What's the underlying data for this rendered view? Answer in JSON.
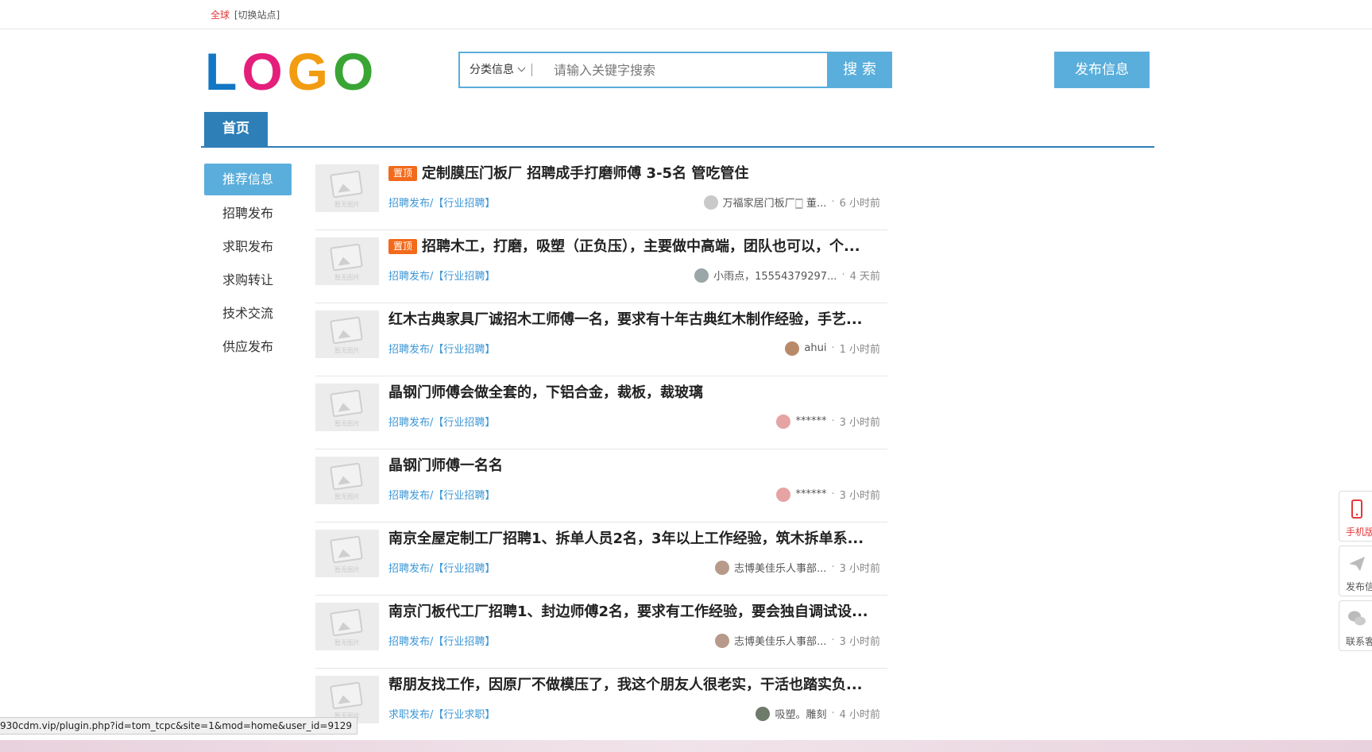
{
  "topbar": {
    "global": "全球",
    "switch": "[切换站点]"
  },
  "logo": {
    "letters": [
      "L",
      "O",
      "G",
      "O"
    ]
  },
  "search": {
    "category": "分类信息",
    "placeholder": "请输入关键字搜索",
    "button": "搜 索"
  },
  "publish_button": "发布信息",
  "nav": {
    "home": "首页"
  },
  "sidebar": {
    "items": [
      {
        "label": "推荐信息",
        "active": true
      },
      {
        "label": "招聘发布",
        "active": false
      },
      {
        "label": "求职发布",
        "active": false
      },
      {
        "label": "求购转让",
        "active": false
      },
      {
        "label": "技术交流",
        "active": false
      },
      {
        "label": "供应发布",
        "active": false
      }
    ]
  },
  "listing": {
    "thumb_caption": "暂无图片",
    "badge": "置顶",
    "items": [
      {
        "title": "定制膜压门板厂 招聘成手打磨师傅 3-5名 管吃管住",
        "top": true,
        "category": "招聘发布/【行业招聘】",
        "author": "万福家居门板厂🀆 董...",
        "time": "6 小时前",
        "avatar": "#c9c9c9"
      },
      {
        "title": "招聘木工，打磨，吸塑（正负压），主要做中高端，团队也可以，个...",
        "top": true,
        "category": "招聘发布/【行业招聘】",
        "author": "小雨点，15554379297...",
        "time": "4 天前",
        "avatar": "#9aa6a8"
      },
      {
        "title": "红木古典家具厂诚招木工师傅一名，要求有十年古典红木制作经验，手艺...",
        "top": false,
        "category": "招聘发布/【行业招聘】",
        "author": "ahui",
        "time": "1 小时前",
        "avatar": "#b98a6a"
      },
      {
        "title": "晶钢门师傅会做全套的，下铝合金，裁板，裁玻璃",
        "top": false,
        "category": "招聘发布/【行业招聘】",
        "author": "******",
        "time": "3 小时前",
        "avatar": "#e6a3a3"
      },
      {
        "title": "晶钢门师傅一名名",
        "top": false,
        "category": "招聘发布/【行业招聘】",
        "author": "******",
        "time": "3 小时前",
        "avatar": "#e6a3a3"
      },
      {
        "title": "南京全屋定制工厂招聘1、拆单人员2名，3年以上工作经验，筑木拆单系...",
        "top": false,
        "category": "招聘发布/【行业招聘】",
        "author": "志博美佳乐人事部...",
        "time": "3 小时前",
        "avatar": "#b89a8a"
      },
      {
        "title": "南京门板代工厂招聘1、封边师傅2名，要求有工作经验，要会独自调试设...",
        "top": false,
        "category": "招聘发布/【行业招聘】",
        "author": "志博美佳乐人事部...",
        "time": "3 小时前",
        "avatar": "#b89a8a"
      },
      {
        "title": "帮朋友找工作，因原厂不做模压了，我这个朋友人很老实，干活也踏实负...",
        "top": false,
        "category": "求职发布/【行业求职】",
        "author": "吸塑。雕刻",
        "time": "4 小时前",
        "avatar": "#6e7a6a"
      }
    ]
  },
  "floaters": [
    {
      "label": "手机版",
      "icon": "phone-icon"
    },
    {
      "label": "发布信息",
      "icon": "paper-plane-icon"
    },
    {
      "label": "联系客服",
      "icon": "wechat-icon"
    }
  ],
  "status_url": "930cdm.vip/plugin.php?id=tom_tcpc&site=1&mod=home&user_id=9129",
  "colors": {
    "accent": "#5aaedb",
    "nav": "#2e7fb8",
    "badge": "#f26a1b",
    "link": "#3d97d6"
  }
}
